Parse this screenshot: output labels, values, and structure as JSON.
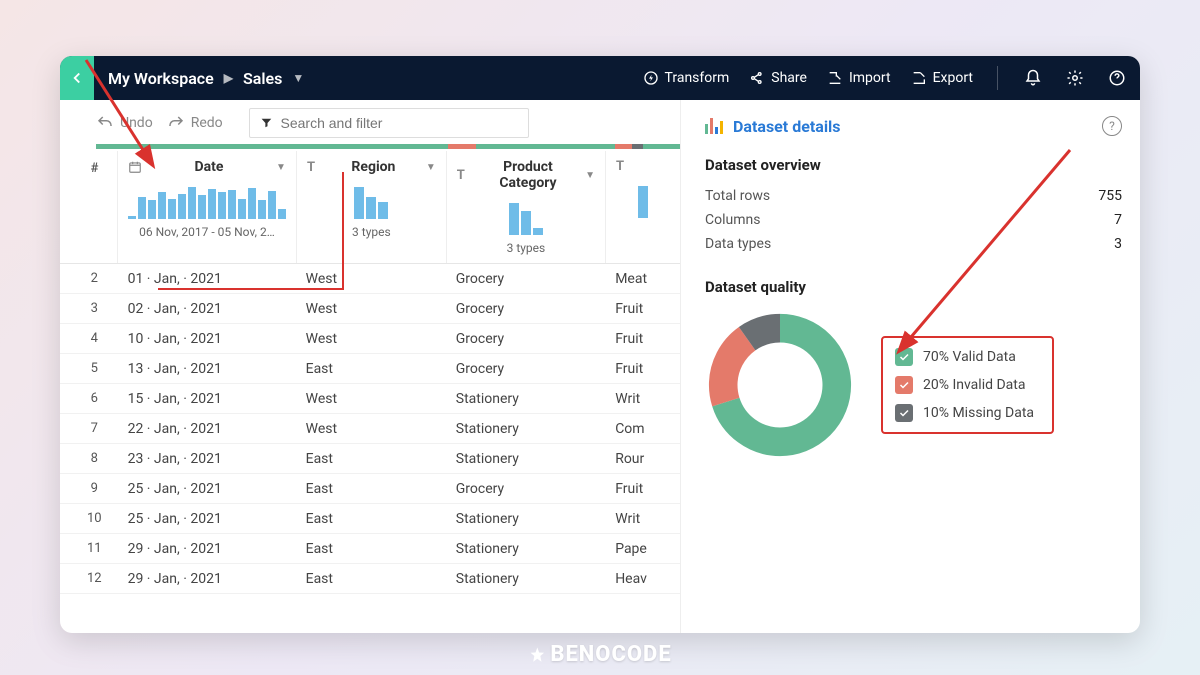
{
  "breadcrumbs": {
    "workspace": "My Workspace",
    "dataset": "Sales"
  },
  "topbar": {
    "transform": "Transform",
    "share": "Share",
    "import": "Import",
    "export": "Export"
  },
  "toolbar": {
    "undo": "Undo",
    "redo": "Redo",
    "search_placeholder": "Search and filter"
  },
  "columns": {
    "row_num_label": "#",
    "date": {
      "label": "Date",
      "sub": "06 Nov, 2017 - 05 Nov, 2…"
    },
    "region": {
      "label": "Region",
      "sub": "3 types"
    },
    "category": {
      "label": "Product Category",
      "sub": "3 types"
    }
  },
  "rows": [
    {
      "n": "2",
      "date": "01 · Jan, · 2021",
      "region": "West",
      "cat": "Grocery",
      "extra": "Meat"
    },
    {
      "n": "3",
      "date": "02 · Jan, · 2021",
      "region": "West",
      "cat": "Grocery",
      "extra": "Fruit"
    },
    {
      "n": "4",
      "date": "10 · Jan, · 2021",
      "region": "West",
      "cat": "Grocery",
      "extra": "Fruit"
    },
    {
      "n": "5",
      "date": "13 · Jan, · 2021",
      "region": "East",
      "cat": "Grocery",
      "extra": "Fruit"
    },
    {
      "n": "6",
      "date": "15 · Jan, · 2021",
      "region": "West",
      "cat": "Stationery",
      "extra": "Writ"
    },
    {
      "n": "7",
      "date": "22 · Jan, · 2021",
      "region": "West",
      "cat": "Stationery",
      "extra": "Com"
    },
    {
      "n": "8",
      "date": "23 · Jan, · 2021",
      "region": "East",
      "cat": "Stationery",
      "extra": "Rour"
    },
    {
      "n": "9",
      "date": "25 · Jan, · 2021",
      "region": "East",
      "cat": "Grocery",
      "extra": "Fruit"
    },
    {
      "n": "10",
      "date": "25 · Jan, · 2021",
      "region": "East",
      "cat": "Stationery",
      "extra": "Writ"
    },
    {
      "n": "11",
      "date": "29 · Jan, · 2021",
      "region": "East",
      "cat": "Stationery",
      "extra": "Pape"
    },
    {
      "n": "12",
      "date": "29 · Jan, · 2021",
      "region": "East",
      "cat": "Stationery",
      "extra": "Heav"
    }
  ],
  "panel": {
    "title": "Dataset details",
    "overview_h": "Dataset overview",
    "quality_h": "Dataset quality",
    "overview": {
      "total_rows_label": "Total rows",
      "total_rows_val": "755",
      "columns_label": "Columns",
      "columns_val": "7",
      "datatypes_label": "Data types",
      "datatypes_val": "3"
    },
    "legend": {
      "valid": "70% Valid Data",
      "invalid": "20% Invalid Data",
      "missing": "10% Missing Data"
    }
  },
  "colors": {
    "accent_green": "#62b893",
    "accent_red": "#e47a6a",
    "accent_grey": "#6a6f73",
    "blue_bar": "#6fbce8",
    "header_bg": "#0a1931",
    "back_btn": "#3ccfa2",
    "anno_red": "#d9322e"
  },
  "chart_data": {
    "type": "pie",
    "title": "Dataset quality",
    "series": [
      {
        "name": "Valid Data",
        "value": 70,
        "color": "#62b893"
      },
      {
        "name": "Invalid Data",
        "value": 20,
        "color": "#e47a6a"
      },
      {
        "name": "Missing Data",
        "value": 10,
        "color": "#6a6f73"
      }
    ]
  },
  "watermark": "BENOCODE"
}
